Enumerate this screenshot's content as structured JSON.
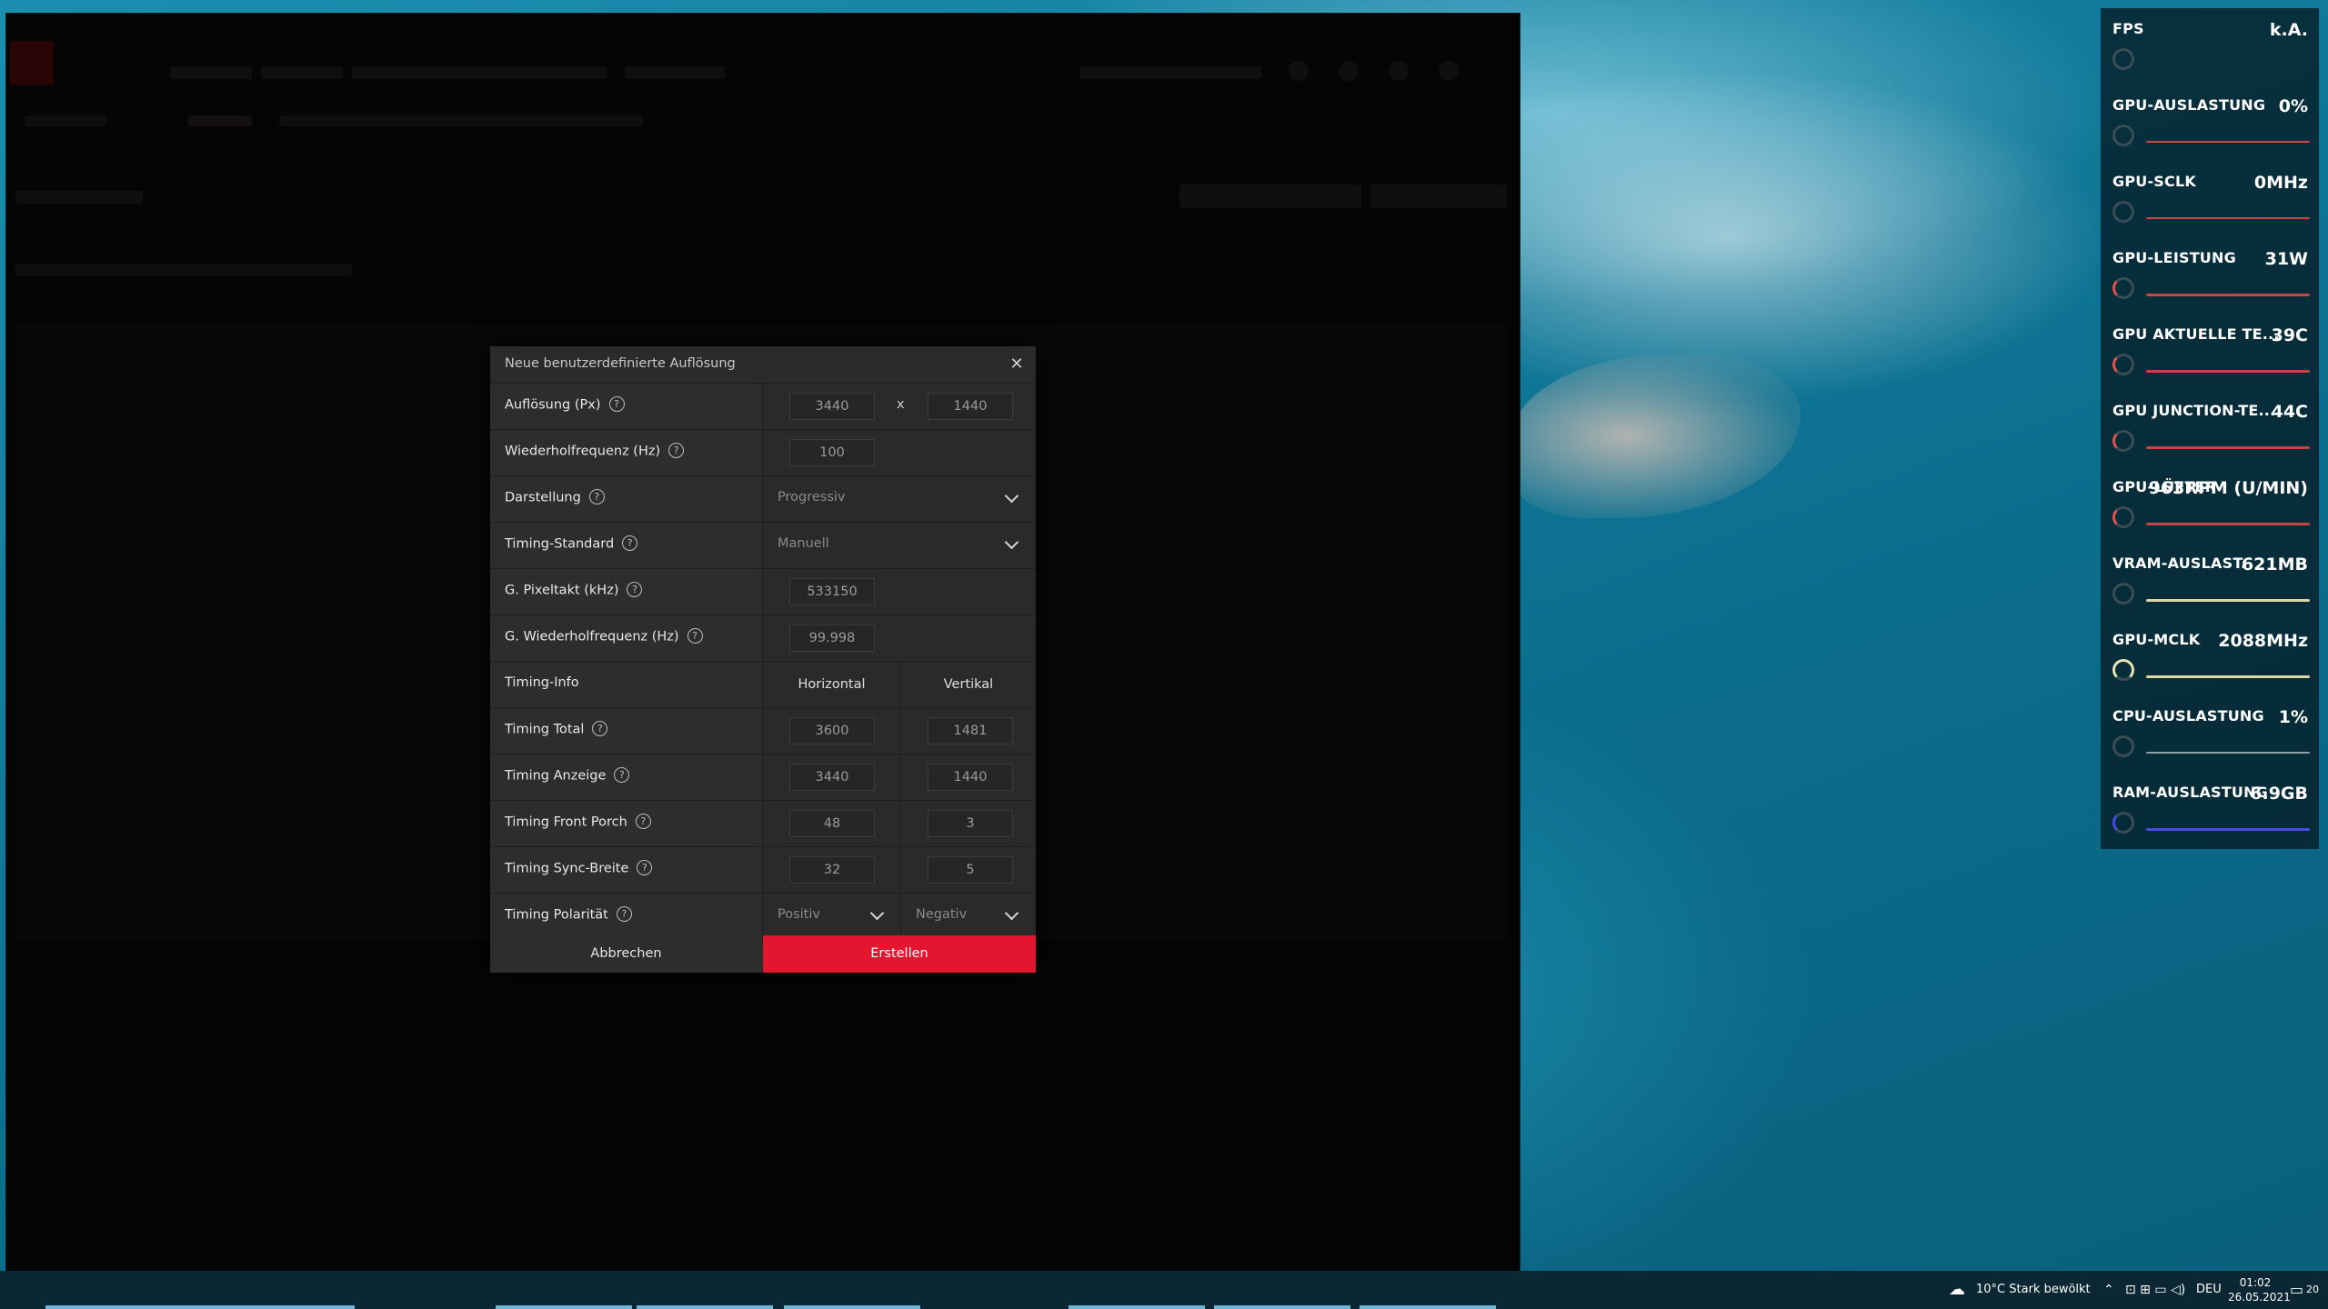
{
  "dialog": {
    "title": "Neue benutzerdefinierte Auflösung",
    "rows": {
      "resolution": {
        "label": "Auflösung (Px)",
        "h": "3440",
        "sep": "x",
        "v": "1440"
      },
      "refresh": {
        "label": "Wiederholfrequenz (Hz)",
        "value": "100"
      },
      "scan": {
        "label": "Darstellung",
        "selected": "Progressiv"
      },
      "timing_standard": {
        "label": "Timing-Standard",
        "selected": "Manuell"
      },
      "pixel_clock": {
        "label": "G. Pixeltakt (kHz)",
        "value": "533150"
      },
      "eff_refresh": {
        "label": "G. Wiederholfrequenz (Hz)",
        "value": "99.998"
      },
      "timing_info": {
        "label": "Timing-Info",
        "h_head": "Horizontal",
        "v_head": "Vertikal"
      },
      "timing_total": {
        "label": "Timing Total",
        "h": "3600",
        "v": "1481"
      },
      "timing_display": {
        "label": "Timing Anzeige",
        "h": "3440",
        "v": "1440"
      },
      "timing_front_porch": {
        "label": "Timing Front Porch",
        "h": "48",
        "v": "3"
      },
      "timing_sync_width": {
        "label": "Timing Sync-Breite",
        "h": "32",
        "v": "5"
      },
      "timing_polarity": {
        "label": "Timing Polarität",
        "h": "Positiv",
        "v": "Negativ"
      }
    },
    "cancel_label": "Abbrechen",
    "create_label": "Erstellen",
    "help_glyph": "?",
    "close_glyph": "✕"
  },
  "overlay": {
    "metrics": [
      {
        "label": "FPS",
        "value": "k.A.",
        "color": "#3a4d56"
      },
      {
        "label": "GPU-AUSLASTUNG",
        "value": "0%",
        "color": "#e35050"
      },
      {
        "label": "GPU-SCLK",
        "value": "0MHz",
        "color": "#e35050"
      },
      {
        "label": "GPU-LEISTUNG",
        "value": "31W",
        "color": "#e35050"
      },
      {
        "label": "GPU AKTUELLE TE...",
        "value": "39C",
        "color": "#e35050"
      },
      {
        "label": "GPU JUNCTION-TE...",
        "value": "44C",
        "color": "#e35050"
      },
      {
        "label": "GPU-LÜFTER",
        "value": "963RPM (U/MIN)",
        "color": "#e35050"
      },
      {
        "label": "VRAM-AUSLAST.",
        "value": "621MB",
        "color": "#e8e4b0"
      },
      {
        "label": "GPU-MCLK",
        "value": "2088MHz",
        "color": "#e8e4b0"
      },
      {
        "label": "CPU-AUSLASTUNG",
        "value": "1%",
        "color": "#b8c4c8"
      },
      {
        "label": "RAM-AUSLASTUNG",
        "value": "6.9GB",
        "color": "#4a4ae0"
      }
    ]
  },
  "taskbar": {
    "weather": "10°C  Stark bewölkt",
    "language": "DEU",
    "time": "01:02",
    "date": "26.05.2021",
    "notification_count": "20"
  }
}
